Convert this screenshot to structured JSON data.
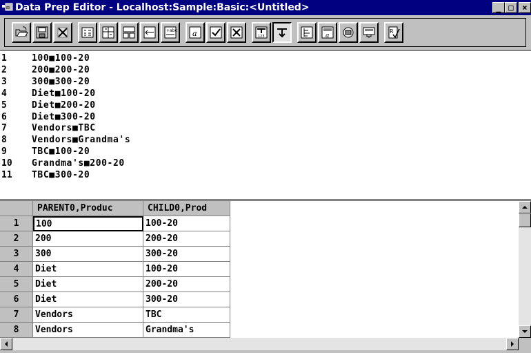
{
  "window": {
    "title": "Data Prep Editor - Localhost:Sample:Basic:<Untitled>",
    "minimize_glyph": "_",
    "restore_glyph": "□",
    "close_glyph": "×"
  },
  "toolbar": {
    "buttons": [
      {
        "name": "open-file-icon"
      },
      {
        "name": "save-icon"
      },
      {
        "name": "close-file-icon"
      },
      {
        "name": "field-properties-icon"
      },
      {
        "name": "move-field-icon"
      },
      {
        "name": "split-field-icon"
      },
      {
        "name": "join-fields-icon"
      },
      {
        "name": "create-field-text-icon"
      },
      {
        "name": "data-file-properties-icon"
      },
      {
        "name": "associate-outline-icon"
      },
      {
        "name": "ignore-field-icon"
      },
      {
        "name": "data-load-settings-icon"
      },
      {
        "name": "select-record-icon"
      },
      {
        "name": "dimension-build-settings-icon"
      },
      {
        "name": "field-edits-icon"
      },
      {
        "name": "view-data-icon"
      },
      {
        "name": "view-dimension-build-icon"
      },
      {
        "name": "validate-icon"
      }
    ]
  },
  "preview": {
    "lines": [
      {
        "num": "1",
        "text": "100■100-20"
      },
      {
        "num": "2",
        "text": "200■200-20"
      },
      {
        "num": "3",
        "text": "300■300-20"
      },
      {
        "num": "4",
        "text": "Diet■100-20"
      },
      {
        "num": "5",
        "text": "Diet■200-20"
      },
      {
        "num": "6",
        "text": "Diet■300-20"
      },
      {
        "num": "7",
        "text": "Vendors■TBC"
      },
      {
        "num": "8",
        "text": "Vendors■Grandma's"
      },
      {
        "num": "9",
        "text": "TBC■100-20"
      },
      {
        "num": "10",
        "text": "Grandma's■200-20"
      },
      {
        "num": "11",
        "text": "TBC■300-20"
      }
    ]
  },
  "grid": {
    "columns": [
      "PARENT0,Produc",
      "CHILD0,Prod"
    ],
    "rows": [
      {
        "num": "1",
        "cells": [
          "100",
          "100-20"
        ]
      },
      {
        "num": "2",
        "cells": [
          "200",
          "200-20"
        ]
      },
      {
        "num": "3",
        "cells": [
          "300",
          "300-20"
        ]
      },
      {
        "num": "4",
        "cells": [
          "Diet",
          "100-20"
        ]
      },
      {
        "num": "5",
        "cells": [
          "Diet",
          "200-20"
        ]
      },
      {
        "num": "6",
        "cells": [
          "Diet",
          "300-20"
        ]
      },
      {
        "num": "7",
        "cells": [
          "Vendors",
          "TBC"
        ]
      },
      {
        "num": "8",
        "cells": [
          "Vendors",
          "Grandma's"
        ]
      }
    ]
  }
}
